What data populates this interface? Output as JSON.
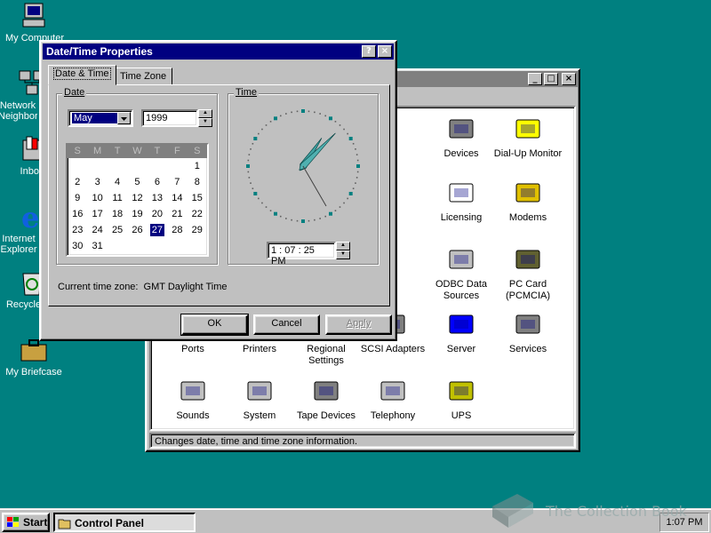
{
  "colors": {
    "desktop": "#008080",
    "title_active": "#000080",
    "title_inactive": "#808080",
    "face": "#c0c0c0"
  },
  "desktop_icons": [
    {
      "label": "My Computer",
      "icon": "computer-icon"
    },
    {
      "label": "Network Neighborhood",
      "icon": "network-icon"
    },
    {
      "label": "Inbox",
      "icon": "inbox-icon"
    },
    {
      "label": "Internet Explorer",
      "icon": "ie-icon"
    },
    {
      "label": "Recycle Bin",
      "icon": "recycle-bin-icon"
    },
    {
      "label": "My Briefcase",
      "icon": "briefcase-icon"
    }
  ],
  "control_panel": {
    "title": "Control Panel",
    "title_fragment": "",
    "partial_labels": [
      "ne",
      "d",
      "k"
    ],
    "items": [
      {
        "label": "Devices",
        "icon": "devices-icon"
      },
      {
        "label": "Dial-Up Monitor",
        "icon": "dialup-monitor-icon"
      },
      {
        "label": "Licensing",
        "icon": "licensing-icon"
      },
      {
        "label": "Modems",
        "icon": "modems-icon"
      },
      {
        "label": "ODBC Data Sources",
        "icon": "odbc-icon"
      },
      {
        "label": "PC Card (PCMCIA)",
        "icon": "pc-card-icon"
      },
      {
        "label": "Ports",
        "icon": "ports-icon"
      },
      {
        "label": "Printers",
        "icon": "printers-icon"
      },
      {
        "label": "Regional Settings",
        "icon": "regional-settings-icon"
      },
      {
        "label": "SCSI Adapters",
        "icon": "scsi-icon"
      },
      {
        "label": "Server",
        "icon": "server-icon"
      },
      {
        "label": "Services",
        "icon": "services-icon"
      },
      {
        "label": "Sounds",
        "icon": "sounds-icon"
      },
      {
        "label": "System",
        "icon": "system-icon"
      },
      {
        "label": "Tape Devices",
        "icon": "tape-devices-icon"
      },
      {
        "label": "Telephony",
        "icon": "telephony-icon"
      },
      {
        "label": "UPS",
        "icon": "ups-icon"
      }
    ],
    "status": "Changes date, time and time zone information."
  },
  "dialog": {
    "title": "Date/Time Properties",
    "help_glyph": "?",
    "close_glyph": "×",
    "tabs": [
      "Date & Time",
      "Time Zone"
    ],
    "active_tab": "Date & Time",
    "date_group": "Date",
    "time_group": "Time",
    "month": "May",
    "year": "1999",
    "day_headers": [
      "S",
      "M",
      "T",
      "W",
      "T",
      "F",
      "S"
    ],
    "calendar": {
      "first_weekday": 6,
      "days": 31,
      "selected_day": 27
    },
    "time": "1 : 07 : 25 PM",
    "clock": {
      "hour": 1,
      "minute": 7,
      "second": 25
    },
    "timezone_label": "Current time zone:",
    "timezone_value": "GMT Daylight Time",
    "buttons": {
      "ok": "OK",
      "cancel": "Cancel",
      "apply": "Apply"
    }
  },
  "taskbar": {
    "start": "Start",
    "task": "Control Panel",
    "clock": "1:07 PM"
  },
  "watermark": "The Collection Book"
}
